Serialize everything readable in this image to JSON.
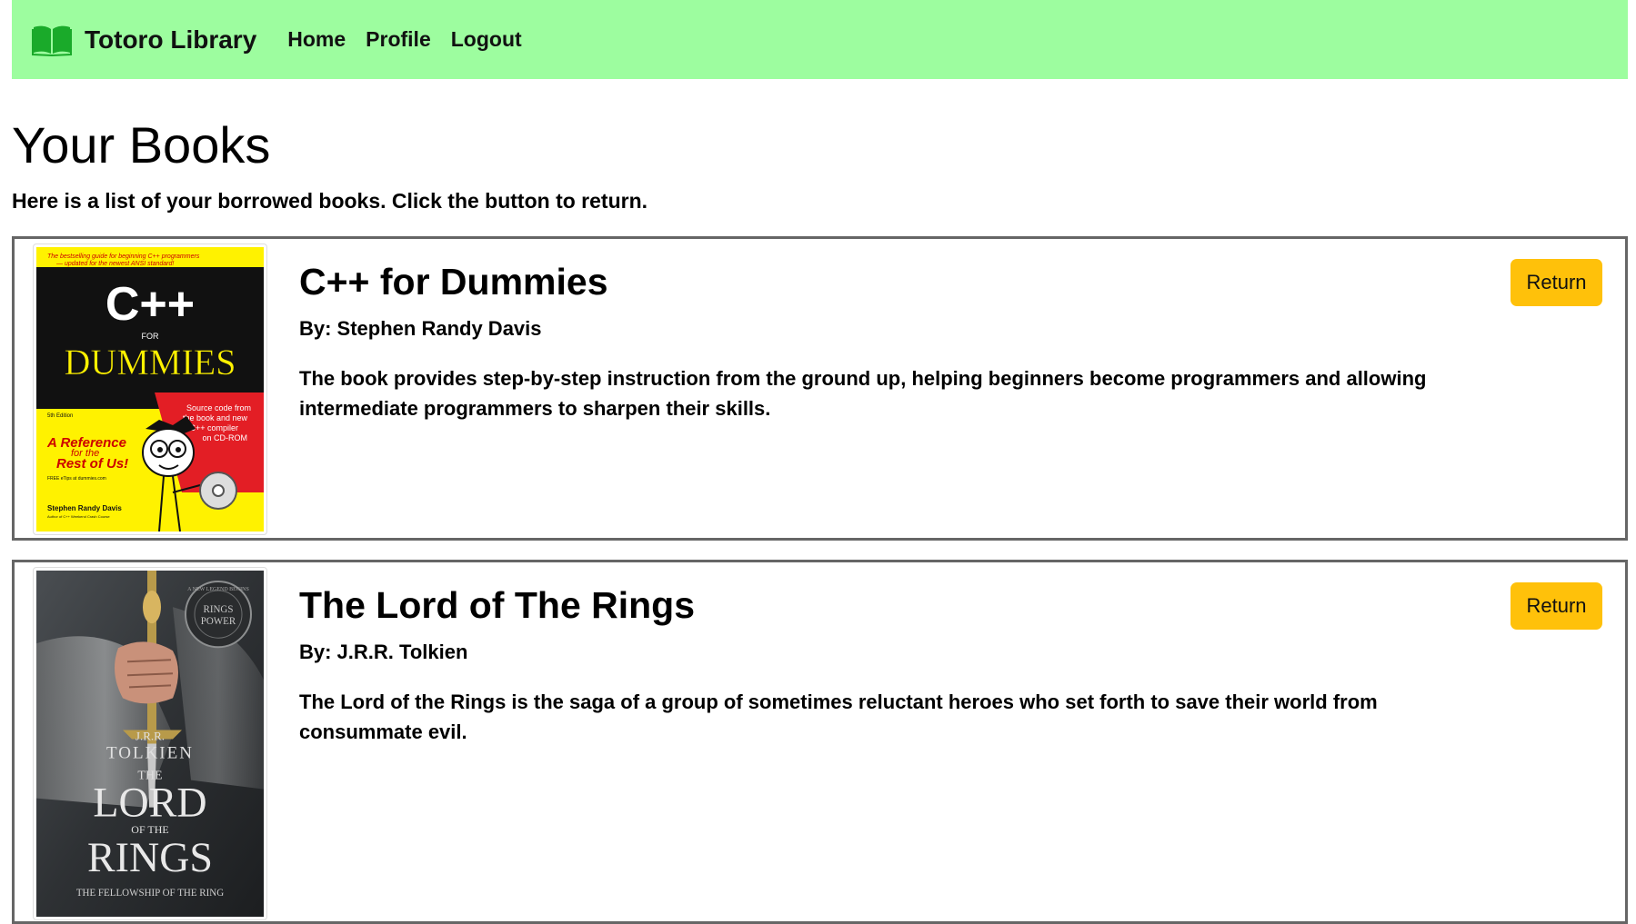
{
  "brand": {
    "name": "Totoro Library",
    "icon": "book-icon",
    "accent": "#9dfd9f",
    "icon_color": "#1aaa2a"
  },
  "nav": {
    "links": [
      "Home",
      "Profile",
      "Logout"
    ]
  },
  "page": {
    "title": "Your Books",
    "subtitle": "Here is a list of your borrowed books. Click the button to return."
  },
  "books": [
    {
      "title": "C++ for Dummies",
      "author": "By: Stephen Randy Davis",
      "description": "The book provides step-by-step instruction from the ground up, helping beginners become programmers and allowing intermediate programmers to sharpen their skills.",
      "button": "Return",
      "cover": {
        "tagline_1": "The bestselling guide for beginning C++ programmers",
        "tagline_2": "— updated for the newest ANSI standard!",
        "title_1": "C++",
        "title_for": "FOR",
        "title_2": "DUMMIES",
        "edition": "5th Edition",
        "cd_1": "Source code from",
        "cd_2": "the book and new",
        "cd_3": "C++ compiler",
        "cd_4": "on CD-ROM",
        "ref_1": "A Reference",
        "ref_2": "for the",
        "ref_3": "Rest of Us!",
        "tips": "FREE eTips at dummies.com",
        "author": "Stephen Randy Davis",
        "author_sub": "Author of C++ Weekend Crash Course"
      }
    },
    {
      "title": "The Lord of The Rings",
      "author": "By: J.R.R. Tolkien",
      "description": "The Lord of the Rings is the saga of a group of sometimes reluctant heroes who set forth to save their world from consummate evil.",
      "button": "Return",
      "cover": {
        "badge_1": "RINGS",
        "badge_2": "POWER",
        "badge_arc": "A NEW LEGEND BEGINS",
        "author_1": "J.R.R.",
        "author_2": "TOLKIEN",
        "title_the": "THE",
        "title_lord": "LORD",
        "title_of": "OF THE",
        "title_rings": "RINGS",
        "subtitle": "THE FELLOWSHIP OF THE RING"
      }
    }
  ],
  "button_color": "#ffc10a"
}
